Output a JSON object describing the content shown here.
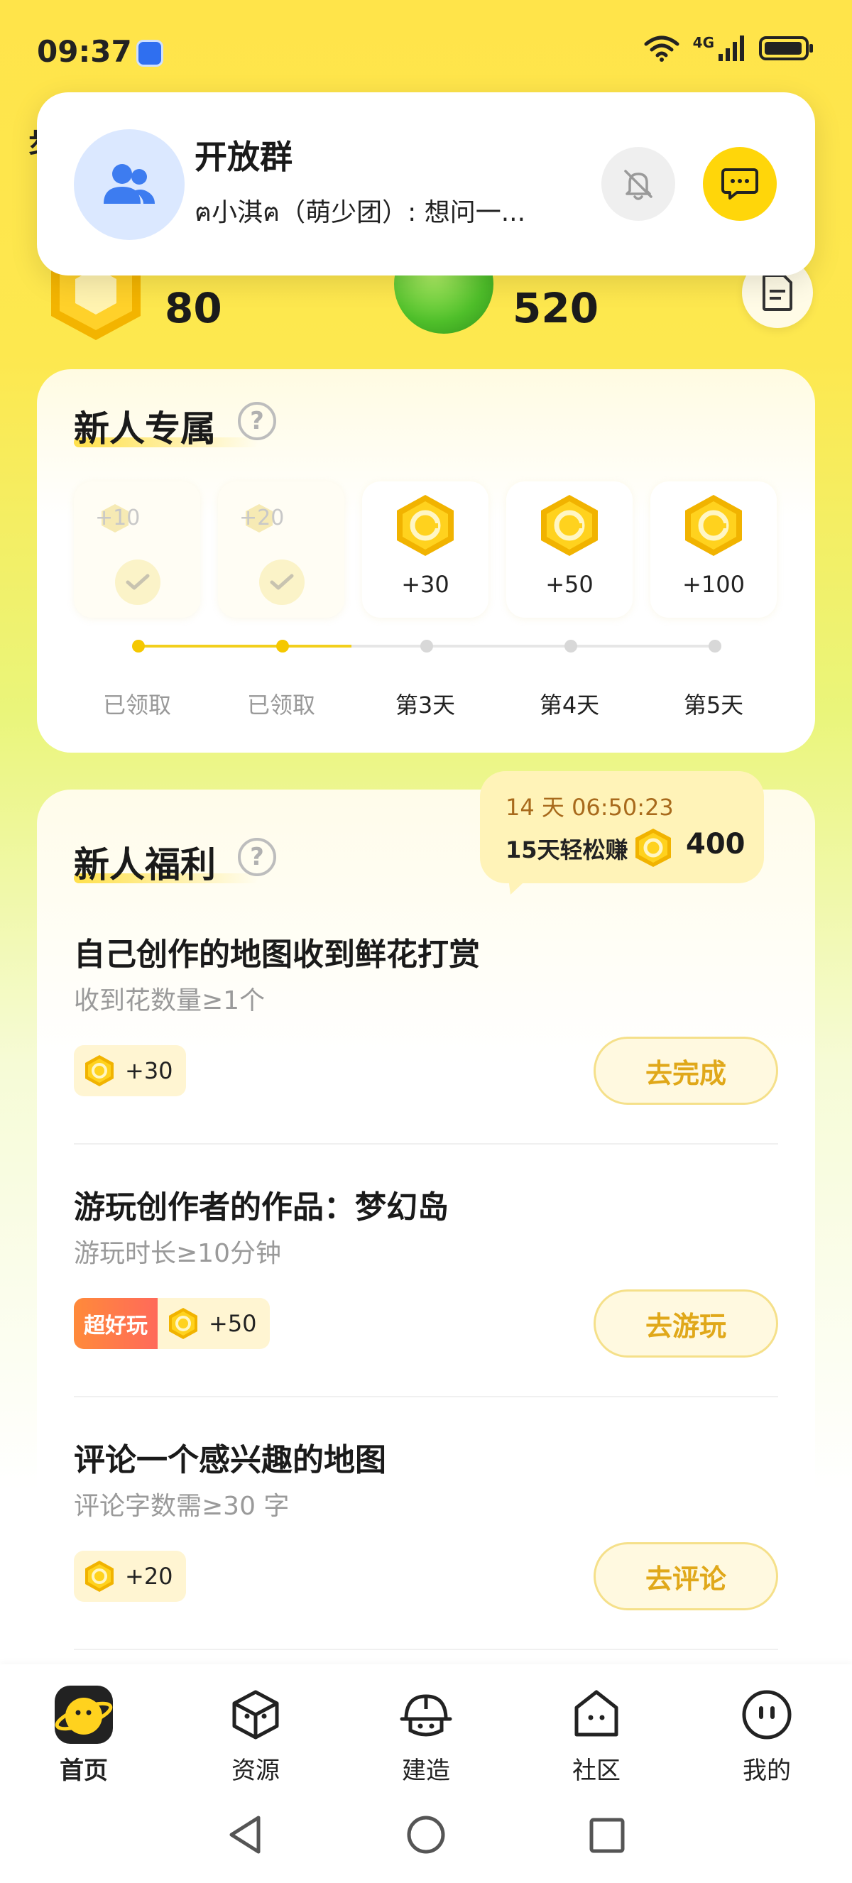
{
  "status_bar": {
    "time": "09:37",
    "network": "4G"
  },
  "header": {
    "leading_char": "步",
    "stat_gold": "80",
    "stat_green": "520"
  },
  "notification": {
    "title": "开放群",
    "message": "ฅ小淇ฅ（萌少团）: 想问一..."
  },
  "newcomer_exclusive": {
    "title": "新人专属",
    "help": "?",
    "days": [
      {
        "amount": "+10",
        "label": "已领取",
        "claimed": true
      },
      {
        "amount": "+20",
        "label": "已领取",
        "claimed": true
      },
      {
        "amount": "+30",
        "label": "第3天",
        "claimed": false
      },
      {
        "amount": "+50",
        "label": "第4天",
        "claimed": false
      },
      {
        "amount": "+100",
        "label": "第5天",
        "claimed": false
      }
    ]
  },
  "bubble": {
    "timer": "14 天 06:50:23",
    "text": "15天轻松赚",
    "amount": "400"
  },
  "newcomer_benefits": {
    "title": "新人福利",
    "help": "?",
    "tasks": [
      {
        "title": "自己创作的地图收到鲜花打赏",
        "sub": "收到花数量≥1个",
        "reward": "+30",
        "button": "去完成"
      },
      {
        "title": "游玩创作者的作品：梦幻岛",
        "sub": "游玩时长≥10分钟",
        "tag": "超好玩",
        "reward": "+50",
        "button": "去游玩"
      },
      {
        "title": "评论一个感兴趣的地图",
        "sub": "评论字数需≥30 字",
        "reward": "+20",
        "button": "去评论"
      }
    ]
  },
  "bottom_nav": [
    {
      "label": "首页",
      "icon": "planet-home-icon",
      "active": true
    },
    {
      "label": "资源",
      "icon": "cube-icon",
      "active": false
    },
    {
      "label": "建造",
      "icon": "helmet-icon",
      "active": false
    },
    {
      "label": "社区",
      "icon": "community-icon",
      "active": false
    },
    {
      "label": "我的",
      "icon": "face-icon",
      "active": false
    }
  ],
  "colors": {
    "accent": "#ffd60a",
    "button_text": "#e0a81a",
    "background_top": "#ffe44a"
  }
}
